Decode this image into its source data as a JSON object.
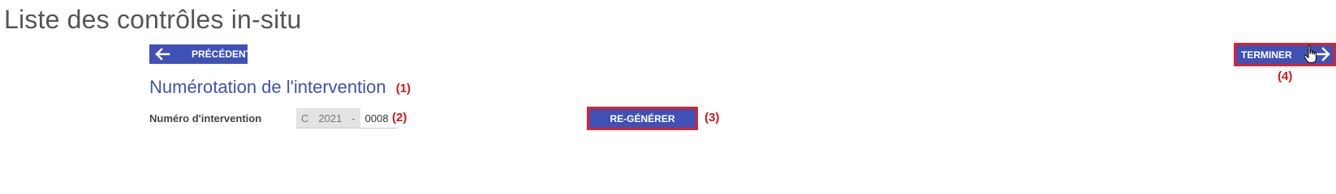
{
  "page": {
    "title": "Liste des contrôles in-situ"
  },
  "toolbar": {
    "previous_label": "PRÉCÉDENT",
    "finish_label": "TERMINER"
  },
  "section": {
    "title": "Numérotation de l'intervention"
  },
  "intervention_number": {
    "label": "Numéro d'intervention",
    "prefix": "C",
    "year": "2021",
    "separator": "-",
    "sequence": "0008"
  },
  "regenerate": {
    "label": "RE-GÉNÉRER"
  },
  "annotations": {
    "a1": "(1)",
    "a2": "(2)",
    "a3": "(3)",
    "a4": "(4)"
  },
  "icons": {
    "previous": "arrow-left-icon",
    "finish": "arrow-right-icon",
    "cursor": "hand-pointer-cursor-icon"
  },
  "colors": {
    "primary": "#3f51b5",
    "annotation": "#d7131c",
    "title": "#555555",
    "readonly_bg": "#e3e3e3"
  }
}
